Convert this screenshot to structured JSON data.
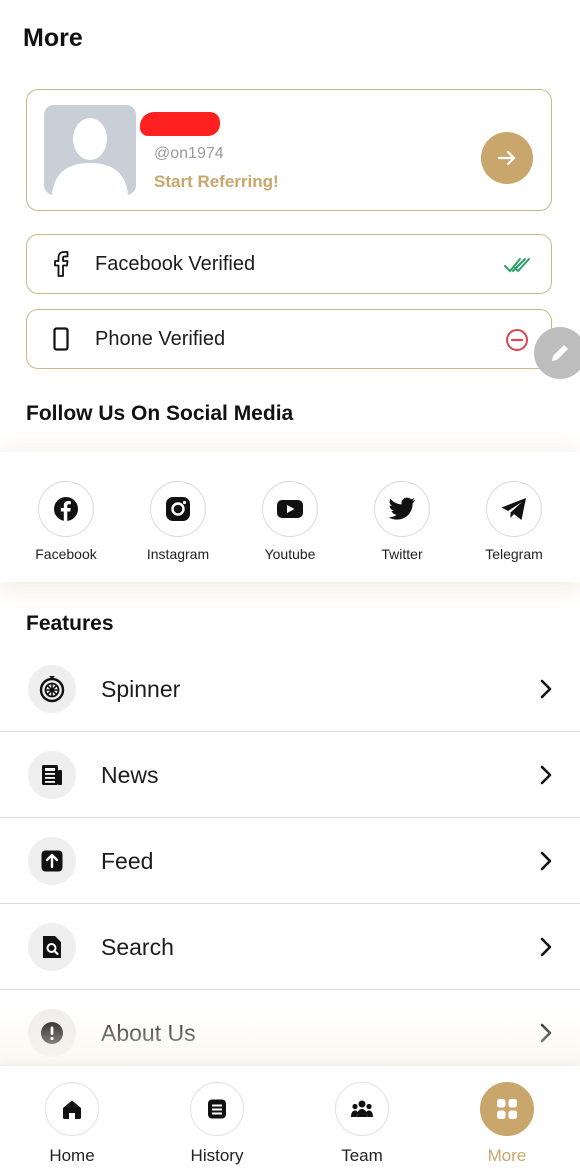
{
  "header": {
    "title": "More"
  },
  "profile": {
    "username": "@on1974",
    "cta": "Start Referring!"
  },
  "verification": [
    {
      "label": "Facebook Verified",
      "icon": "facebook-f-icon",
      "status": "verified"
    },
    {
      "label": "Phone Verified",
      "icon": "phone-icon",
      "status": "not-verified"
    }
  ],
  "social": {
    "title": "Follow Us On Social Media",
    "items": [
      {
        "label": "Facebook",
        "icon": "facebook-icon"
      },
      {
        "label": "Instagram",
        "icon": "instagram-icon"
      },
      {
        "label": "Youtube",
        "icon": "youtube-icon"
      },
      {
        "label": "Twitter",
        "icon": "twitter-icon"
      },
      {
        "label": "Telegram",
        "icon": "telegram-icon"
      }
    ]
  },
  "features": {
    "title": "Features",
    "items": [
      {
        "label": "Spinner",
        "icon": "spinner-wheel-icon"
      },
      {
        "label": "News",
        "icon": "newspaper-icon"
      },
      {
        "label": "Feed",
        "icon": "upload-feed-icon"
      },
      {
        "label": "Search",
        "icon": "search-file-icon"
      },
      {
        "label": "About Us",
        "icon": "info-alert-icon"
      }
    ]
  },
  "nav": {
    "items": [
      {
        "label": "Home",
        "icon": "home-icon",
        "active": false
      },
      {
        "label": "History",
        "icon": "history-icon",
        "active": false
      },
      {
        "label": "Team",
        "icon": "team-icon",
        "active": false
      },
      {
        "label": "More",
        "icon": "grid-icon",
        "active": true
      }
    ]
  },
  "colors": {
    "accent": "#c9a66b",
    "border": "#c9b98a",
    "verified": "#2e9e6a",
    "error": "#e0454f"
  }
}
